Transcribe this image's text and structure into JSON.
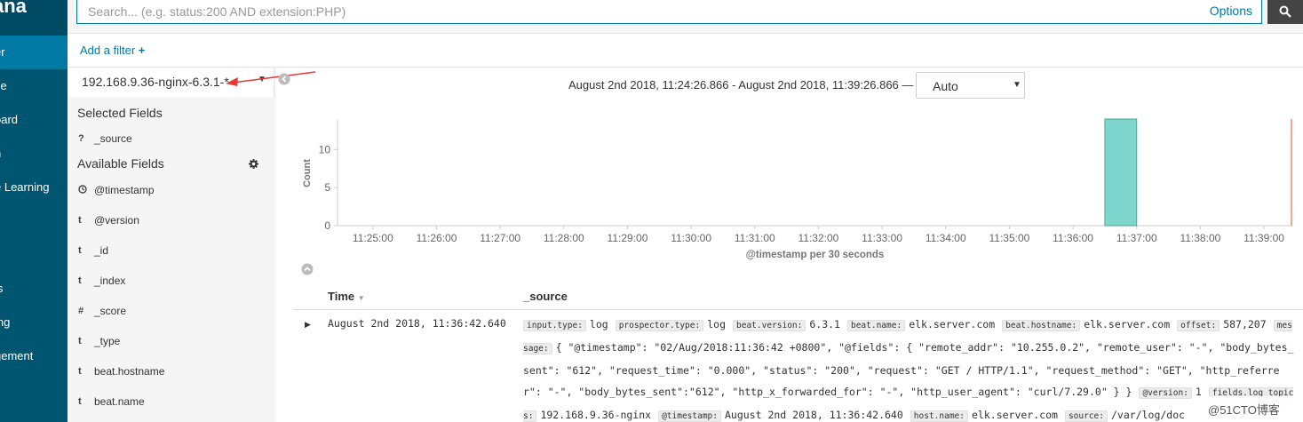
{
  "nav": {
    "brand": "ana",
    "items": [
      "er",
      "ze",
      "oard",
      "n",
      "e Learning",
      "ls",
      "ing",
      "gement"
    ]
  },
  "query": {
    "placeholder": "Search... (e.g. status:200 AND extension:PHP)",
    "options_label": "Options",
    "add_filter_label": "Add a filter"
  },
  "sidebar": {
    "index_pattern": "192.168.9.36-nginx-6.3.1-*",
    "selected_title": "Selected Fields",
    "selected_fields": [
      {
        "type": "?",
        "name": "_source"
      }
    ],
    "available_title": "Available Fields",
    "available_fields": [
      {
        "type": "clock",
        "name": "@timestamp"
      },
      {
        "type": "t",
        "name": "@version"
      },
      {
        "type": "t",
        "name": "_id"
      },
      {
        "type": "t",
        "name": "_index"
      },
      {
        "type": "#",
        "name": "_score"
      },
      {
        "type": "t",
        "name": "_type"
      },
      {
        "type": "t",
        "name": "beat.hostname"
      },
      {
        "type": "t",
        "name": "beat.name"
      }
    ]
  },
  "histogram": {
    "time_range": "August 2nd 2018, 11:24:26.866 - August 2nd 2018, 11:39:26.866 —",
    "interval": "Auto"
  },
  "chart_data": {
    "type": "bar",
    "ylabel": "Count",
    "xlabel": "@timestamp per 30 seconds",
    "categories": [
      "11:25:00",
      "11:26:00",
      "11:27:00",
      "11:28:00",
      "11:29:00",
      "11:30:00",
      "11:31:00",
      "11:32:00",
      "11:33:00",
      "11:34:00",
      "11:35:00",
      "11:36:00",
      "11:37:00",
      "11:38:00",
      "11:39:00"
    ],
    "yticks": [
      0,
      5,
      10
    ],
    "ylim": [
      0,
      14
    ],
    "x_range_minutes": [
      24.444,
      39.446
    ],
    "bars": [
      {
        "start": "11:36:30",
        "value": 14
      }
    ],
    "bar_color": "#7ed6cc",
    "now_marker_color": "#e8a89c"
  },
  "table": {
    "col_time": "Time",
    "col_source": "_source",
    "row": {
      "time": "August 2nd 2018, 11:36:42.640",
      "fields": [
        {
          "k": "input.type:",
          "v": "log"
        },
        {
          "k": "prospector.type:",
          "v": "log"
        },
        {
          "k": "beat.version:",
          "v": "6.3.1"
        },
        {
          "k": "beat.name:",
          "v": "elk.server.com"
        },
        {
          "k": "beat.hostname:",
          "v": "elk.server.com"
        },
        {
          "k": "offset:",
          "v": "587,207"
        },
        {
          "k": "message:",
          "v": "{ \"@timestamp\": \"02/Aug/2018:11:36:42 +0800\", \"@fields\": { \"remote_addr\": \"10.255.0.2\", \"remote_user\": \"-\", \"body_bytes_sent\": \"612\", \"request_time\": \"0.000\", \"status\": \"200\", \"request\": \"GET / HTTP/1.1\", \"request_method\": \"GET\", \"http_referrer\": \"-\", \"body_bytes_sent\":\"612\", \"http_x_forwarded_for\": \"-\", \"http_user_agent\": \"curl/7.29.0\" } }"
        },
        {
          "k": "@version:",
          "v": "1"
        },
        {
          "k": "fields.log_topics:",
          "v": "192.168.9.36-nginx"
        },
        {
          "k": "@timestamp:",
          "v": "August 2nd 2018, 11:36:42.640"
        },
        {
          "k": "host.name:",
          "v": "elk.server.com"
        },
        {
          "k": "source:",
          "v": "/var/log/doc"
        }
      ]
    }
  },
  "watermark": "@51CTO博客",
  "colors": {
    "nav": "#005571",
    "accent": "#0079a5",
    "arrow": "#e53935"
  }
}
